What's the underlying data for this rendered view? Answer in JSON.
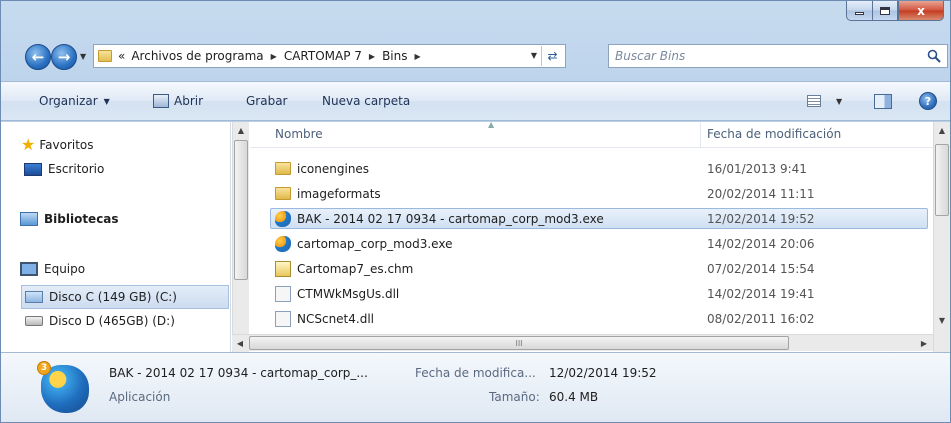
{
  "window": {
    "close_glyph": "x"
  },
  "address": {
    "overflow": "«",
    "crumbs": [
      "Archivos de programa",
      "CARTOMAP 7",
      "Bins"
    ],
    "search_placeholder": "Buscar Bins"
  },
  "toolbar": {
    "organize": "Organizar",
    "open": "Abrir",
    "burn": "Grabar",
    "new_folder": "Nueva carpeta"
  },
  "nav": {
    "favorites": "Favoritos",
    "desktop": "Escritorio",
    "libraries": "Bibliotecas",
    "computer": "Equipo",
    "disk_c": "Disco C  (149 GB) (C:)",
    "disk_d": "Disco D (465GB) (D:)"
  },
  "columns": {
    "name": "Nombre",
    "date": "Fecha de modificación"
  },
  "files": [
    {
      "name": "iconengines",
      "date": "16/01/2013 9:41",
      "type": "folder"
    },
    {
      "name": "imageformats",
      "date": "20/02/2014 11:11",
      "type": "folder"
    },
    {
      "name": "BAK - 2014 02 17 0934 - cartomap_corp_mod3.exe",
      "date": "12/02/2014 19:52",
      "type": "exe",
      "selected": true
    },
    {
      "name": "cartomap_corp_mod3.exe",
      "date": "14/02/2014 20:06",
      "type": "exe"
    },
    {
      "name": "Cartomap7_es.chm",
      "date": "07/02/2014 15:54",
      "type": "chm"
    },
    {
      "name": "CTMWkMsgUs.dll",
      "date": "14/02/2014 19:41",
      "type": "dll"
    },
    {
      "name": "NCScnet4.dll",
      "date": "08/02/2011 16:02",
      "type": "dll"
    }
  ],
  "details": {
    "name": "BAK - 2014 02 17 0934 - cartomap_corp_...",
    "date_label": "Fecha de modifica...",
    "date_value": "12/02/2014 19:52",
    "type": "Aplicación",
    "size_label": "Tamaño:",
    "size_value": "60.4 MB",
    "badge": "3"
  },
  "icons": {
    "back": "arrow-left",
    "forward": "arrow-right",
    "search": "magnifier",
    "help": "question"
  }
}
